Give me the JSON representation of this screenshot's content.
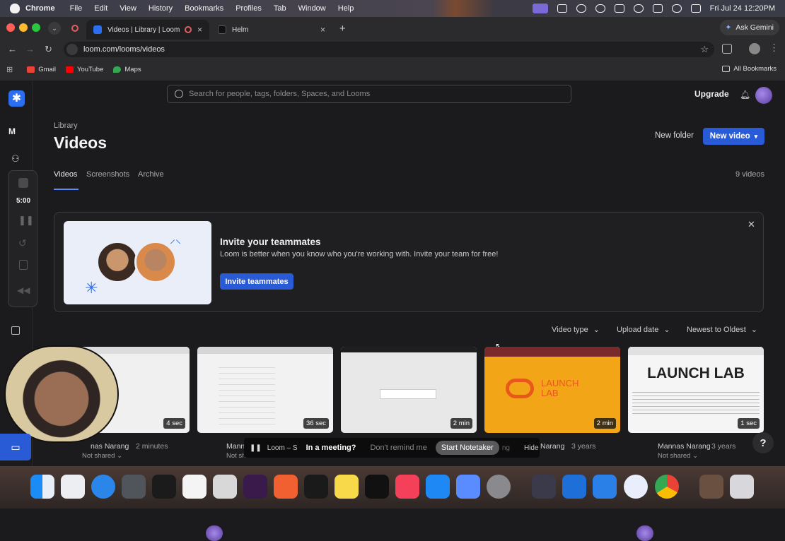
{
  "menubar": {
    "app": "Chrome",
    "items": [
      "File",
      "Edit",
      "View",
      "History",
      "Bookmarks",
      "Profiles",
      "Tab",
      "Window",
      "Help"
    ],
    "datetime": "Fri Jul 24  12:20PM"
  },
  "browser": {
    "tabs": [
      {
        "title": "Videos | Library | Loom",
        "favicon_color": "#2b6ef2"
      },
      {
        "title": "Helm",
        "favicon_color": "#111111"
      }
    ],
    "ask_gemini": "Ask Gemini",
    "url": "loom.com/looms/videos",
    "bookmarks": [
      {
        "label": "Gmail",
        "color": "#ea4335"
      },
      {
        "label": "YouTube",
        "color": "#ff0000"
      },
      {
        "label": "Maps",
        "color": "#34a853"
      }
    ],
    "all_bookmarks": "All Bookmarks"
  },
  "sidebar": {
    "workspace_initial": "M",
    "timer": "5:00"
  },
  "header": {
    "search_placeholder": "Search for people, tags, folders, Spaces, and Looms",
    "upgrade": "Upgrade"
  },
  "page": {
    "breadcrumb": "Library",
    "title": "Videos",
    "new_folder": "New folder",
    "new_video": "New video",
    "tabs": [
      "Videos",
      "Screenshots",
      "Archive"
    ],
    "video_count": "9 videos"
  },
  "invite": {
    "title": "Invite your teammates",
    "subtitle": "Loom is better when you know who you're working with. Invite your team for free!",
    "button": "Invite teammates"
  },
  "filters": {
    "video_type": "Video type",
    "upload_date": "Upload date",
    "sort": "Newest to Oldest"
  },
  "videos": [
    {
      "duration": "4 sec",
      "owner": "Mannas Narang",
      "owner_display": "nas Narang",
      "age": "2 minutes",
      "sharing": "Not shared"
    },
    {
      "duration": "36 sec",
      "owner": "Mann",
      "sharing": "Not sh"
    },
    {
      "duration": "2 min"
    },
    {
      "duration": "2 min",
      "owner_display": "Narang",
      "age": "3 years"
    },
    {
      "duration": "1 sec",
      "owner": "Mannas Narang",
      "age": "3 years",
      "sharing": "Not shared",
      "thumb_text": "LAUNCH LAB"
    }
  ],
  "launch_lab_logo": "LAUNCH LAB",
  "meeting_bar": {
    "recording_label": "Loom – S",
    "prompt": "In a meeting?",
    "dismiss": "Don't remind me",
    "start": "Start Notetaker",
    "hide": "Hide",
    "partial": "ng"
  },
  "help": "?"
}
